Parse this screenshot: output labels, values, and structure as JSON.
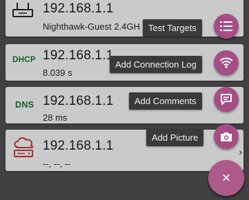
{
  "cards": [
    {
      "ip": "192.168.1.1",
      "subtitle": "Nighthawk-Guest 2.4GH",
      "icon": "router-icon"
    },
    {
      "type_label": "DHCP",
      "ip": "192.168.1.1",
      "subtitle": "8.039 s"
    },
    {
      "type_label": "DNS",
      "ip": "192.168.1.1",
      "subtitle": "28 ms"
    },
    {
      "ip": "192.168.1.1",
      "subtitle": "--, --, --",
      "icon": "cloud-icon",
      "chevron": "›"
    }
  ],
  "fab_menu": {
    "items": [
      {
        "label": "Test Targets",
        "icon": "list-icon"
      },
      {
        "label": "Add Connection Log",
        "icon": "wifi-icon"
      },
      {
        "label": "Add Comments",
        "icon": "comment-icon"
      },
      {
        "label": "Add Picture",
        "icon": "camera-icon"
      }
    ],
    "close_symbol": "×"
  },
  "colors": {
    "accent": "#a64d86",
    "type_label_green": "#1d6b2d",
    "icon_red": "#b23a3a",
    "card_bg": "#e6e6e6",
    "background": "#4a4a4a",
    "tooltip_bg": "#3a3a3a"
  }
}
